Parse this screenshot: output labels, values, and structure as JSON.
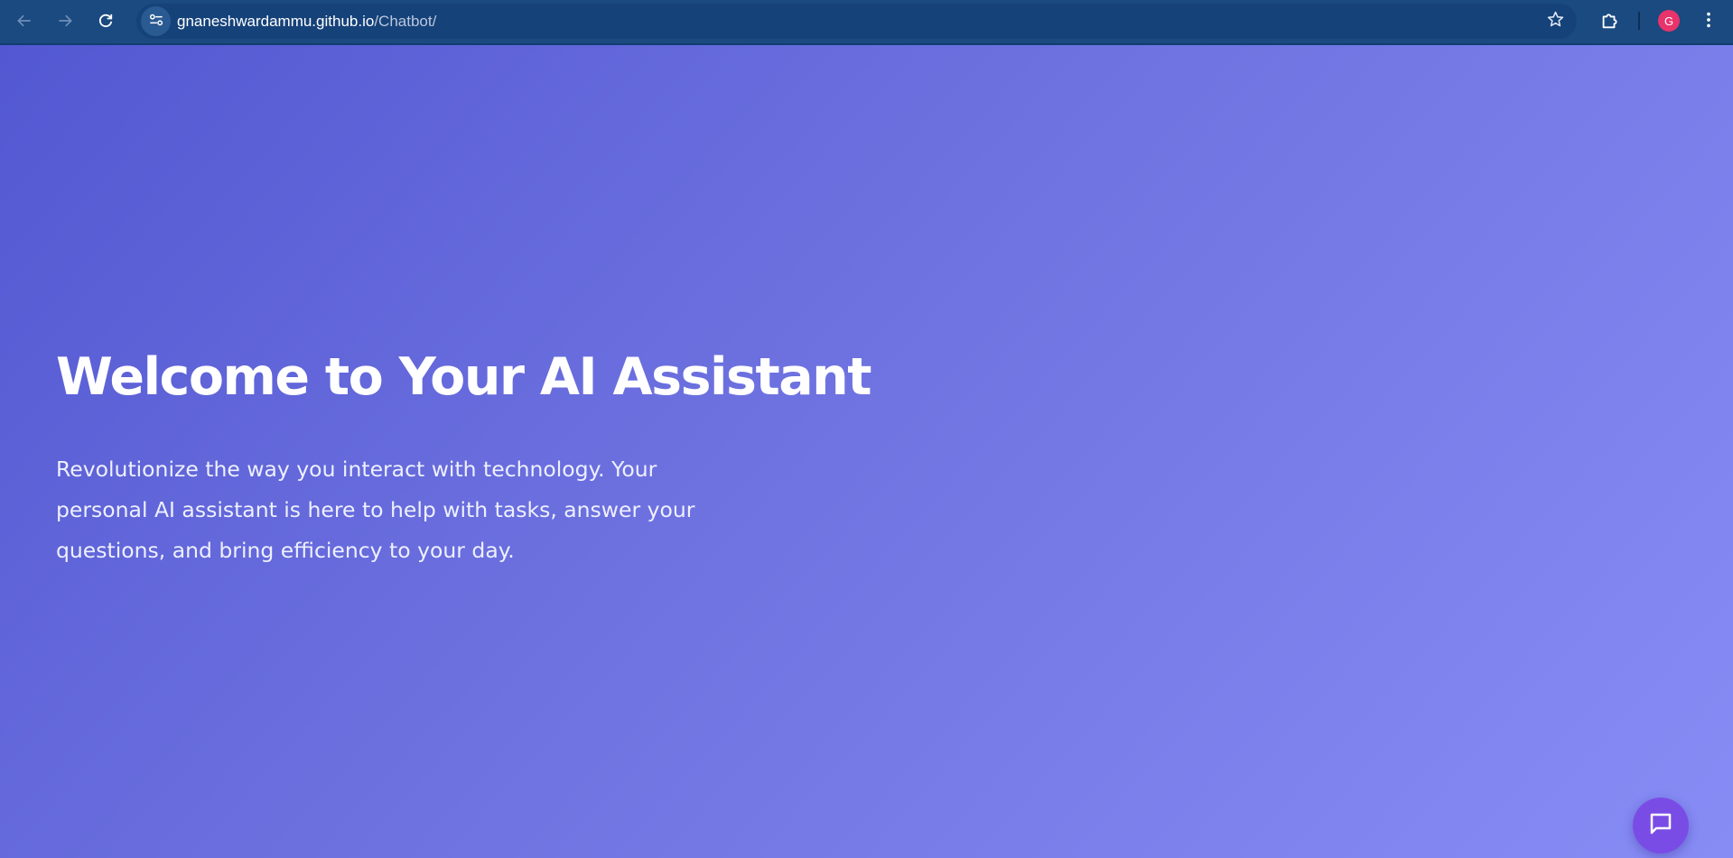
{
  "browser": {
    "url_host": "gnaneshwardammu.github.io",
    "url_path": "/Chatbot/",
    "avatar_initial": "G",
    "toolbar_color": "#1a4a80",
    "avatar_color": "#e8336b"
  },
  "icons": {
    "back": "arrow-left-icon",
    "forward": "arrow-right-icon",
    "reload": "reload-icon",
    "site_info": "tune-icon",
    "bookmark": "star-icon",
    "extensions": "puzzle-icon",
    "menu": "kebab-menu-icon",
    "chat": "chat-bubble-icon"
  },
  "hero": {
    "title": "Welcome to Your AI Assistant",
    "text": "Revolutionize the way you interact with technology. Your personal AI assistant is here to help with tasks, answer your questions, and bring efficiency to your day."
  },
  "theme": {
    "gradient_start": "#5358d2",
    "gradient_end": "#878cf5",
    "chat_button_color": "#7a4ce6"
  }
}
